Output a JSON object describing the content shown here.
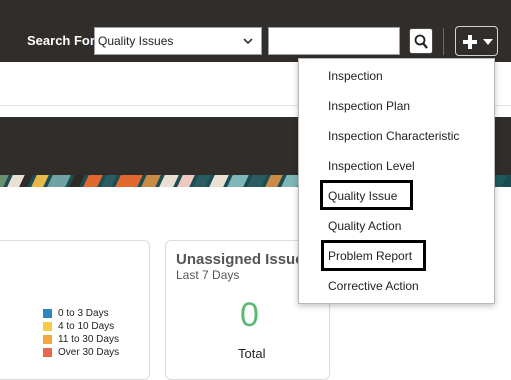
{
  "header": {
    "search_label": "Search For",
    "search_select_value": "Quality Issues",
    "search_input_value": "",
    "search_button_icon": "search-icon",
    "create_button_icon": "plus-icon",
    "create_caret_icon": "caret-down-icon"
  },
  "menu": {
    "items": [
      {
        "label": "Inspection",
        "highlighted": false
      },
      {
        "label": "Inspection Plan",
        "highlighted": false
      },
      {
        "label": "Inspection Characteristic",
        "highlighted": false
      },
      {
        "label": "Inspection Level",
        "highlighted": false
      },
      {
        "label": "Quality Issue",
        "highlighted": true
      },
      {
        "label": "Quality Action",
        "highlighted": false
      },
      {
        "label": "Problem Report",
        "highlighted": true
      },
      {
        "label": "Corrective Action",
        "highlighted": false
      }
    ]
  },
  "legend": {
    "items": [
      {
        "label": "0 to 3 Days",
        "color": "#2e86c1"
      },
      {
        "label": "4 to 10 Days",
        "color": "#f7c948"
      },
      {
        "label": "11 to 30 Days",
        "color": "#f5a742"
      },
      {
        "label": "Over 30 Days",
        "color": "#e8664a"
      }
    ]
  },
  "unassigned_card": {
    "title": "Unassigned Issues",
    "subtitle": "Last 7 Days",
    "value": "0",
    "value_label": "Total"
  },
  "colors": {
    "header_bg": "#312d2a",
    "value_green": "#5bb974"
  }
}
